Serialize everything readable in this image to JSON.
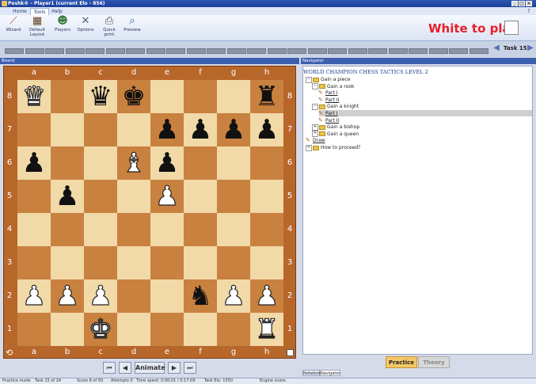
{
  "window": {
    "title": "Peshk® - Player1 (current Elo - 856)"
  },
  "ribbon_tabs": [
    {
      "label": "Home"
    },
    {
      "label": "Tools"
    },
    {
      "label": "Help"
    }
  ],
  "ribbon_buttons": [
    {
      "label": "Wizard",
      "icon": "wizard-icon"
    },
    {
      "label": "Default Layout",
      "icon": "layout-icon"
    },
    {
      "label": "Players",
      "icon": "players-icon"
    },
    {
      "label": "Options",
      "icon": "options-icon"
    },
    {
      "label": "Quick print",
      "icon": "print-icon"
    },
    {
      "label": "Preview",
      "icon": "preview-icon"
    }
  ],
  "turn": {
    "label": "White to play",
    "color": "#e8202a"
  },
  "task": {
    "label": "Task 15"
  },
  "board_panel": {
    "title": "Board",
    "files": [
      "a",
      "b",
      "c",
      "d",
      "e",
      "f",
      "g",
      "h"
    ],
    "ranks": [
      "8",
      "7",
      "6",
      "5",
      "4",
      "3",
      "2",
      "1"
    ],
    "position": [
      [
        "wQ",
        "",
        "bQ",
        "bK",
        "",
        "",
        "",
        "bR"
      ],
      [
        "",
        "",
        "",
        "",
        "bP",
        "bP",
        "bP",
        "bP"
      ],
      [
        "bP",
        "",
        "",
        "wB",
        "bP",
        "",
        "",
        ""
      ],
      [
        "",
        "bP",
        "",
        "",
        "wP",
        "",
        "",
        ""
      ],
      [
        "",
        "",
        "",
        "",
        "",
        "",
        "",
        ""
      ],
      [
        "",
        "",
        "",
        "",
        "",
        "",
        "",
        ""
      ],
      [
        "wP",
        "wP",
        "wP",
        "",
        "",
        "bN",
        "wP",
        "wP"
      ],
      [
        "",
        "",
        "wK",
        "",
        "",
        "",
        "",
        "wR"
      ]
    ],
    "colors": {
      "light": "#f1d9a8",
      "dark": "#c9813f",
      "frame": "#b8672b"
    }
  },
  "nav_controls": {
    "first": "⏮",
    "prev": "◀",
    "animate": "Animate",
    "next": "▶",
    "last": "⏭"
  },
  "navigator": {
    "title": "Navigator",
    "heading": "WORLD CHAMPION CHESS TACTICS LEVEL 2",
    "tree": [
      {
        "label": "Gain a piece",
        "kind": "folder",
        "toggle": "−"
      },
      {
        "label": "Gain a rook",
        "kind": "folder",
        "toggle": "−"
      },
      {
        "label": "Part I",
        "kind": "item"
      },
      {
        "label": "Part II",
        "kind": "item"
      },
      {
        "label": "Gain a knight",
        "kind": "folder",
        "toggle": "−"
      },
      {
        "label": "Part I",
        "kind": "item",
        "selected": true
      },
      {
        "label": "Part II",
        "kind": "item"
      },
      {
        "label": "Gain a bishop",
        "kind": "folder",
        "toggle": "+"
      },
      {
        "label": "Gain a queen",
        "kind": "folder",
        "toggle": "+"
      },
      {
        "label": "Draw",
        "kind": "item"
      },
      {
        "label": "How to proceed?",
        "kind": "folder",
        "toggle": "+"
      }
    ],
    "practice": "Practice",
    "theory": "Theory",
    "tabs": [
      {
        "label": "Notation"
      },
      {
        "label": "Navigator"
      }
    ]
  },
  "status": {
    "mode": "Practice mode",
    "task": "Task 15 of 24",
    "score": "Score 8 of 50",
    "attempts": "Attempts 0",
    "time": "Time spent: 0:00:01 / 0:17:09",
    "elo": "Task Elo: 1550",
    "engine": "Engine score:"
  }
}
